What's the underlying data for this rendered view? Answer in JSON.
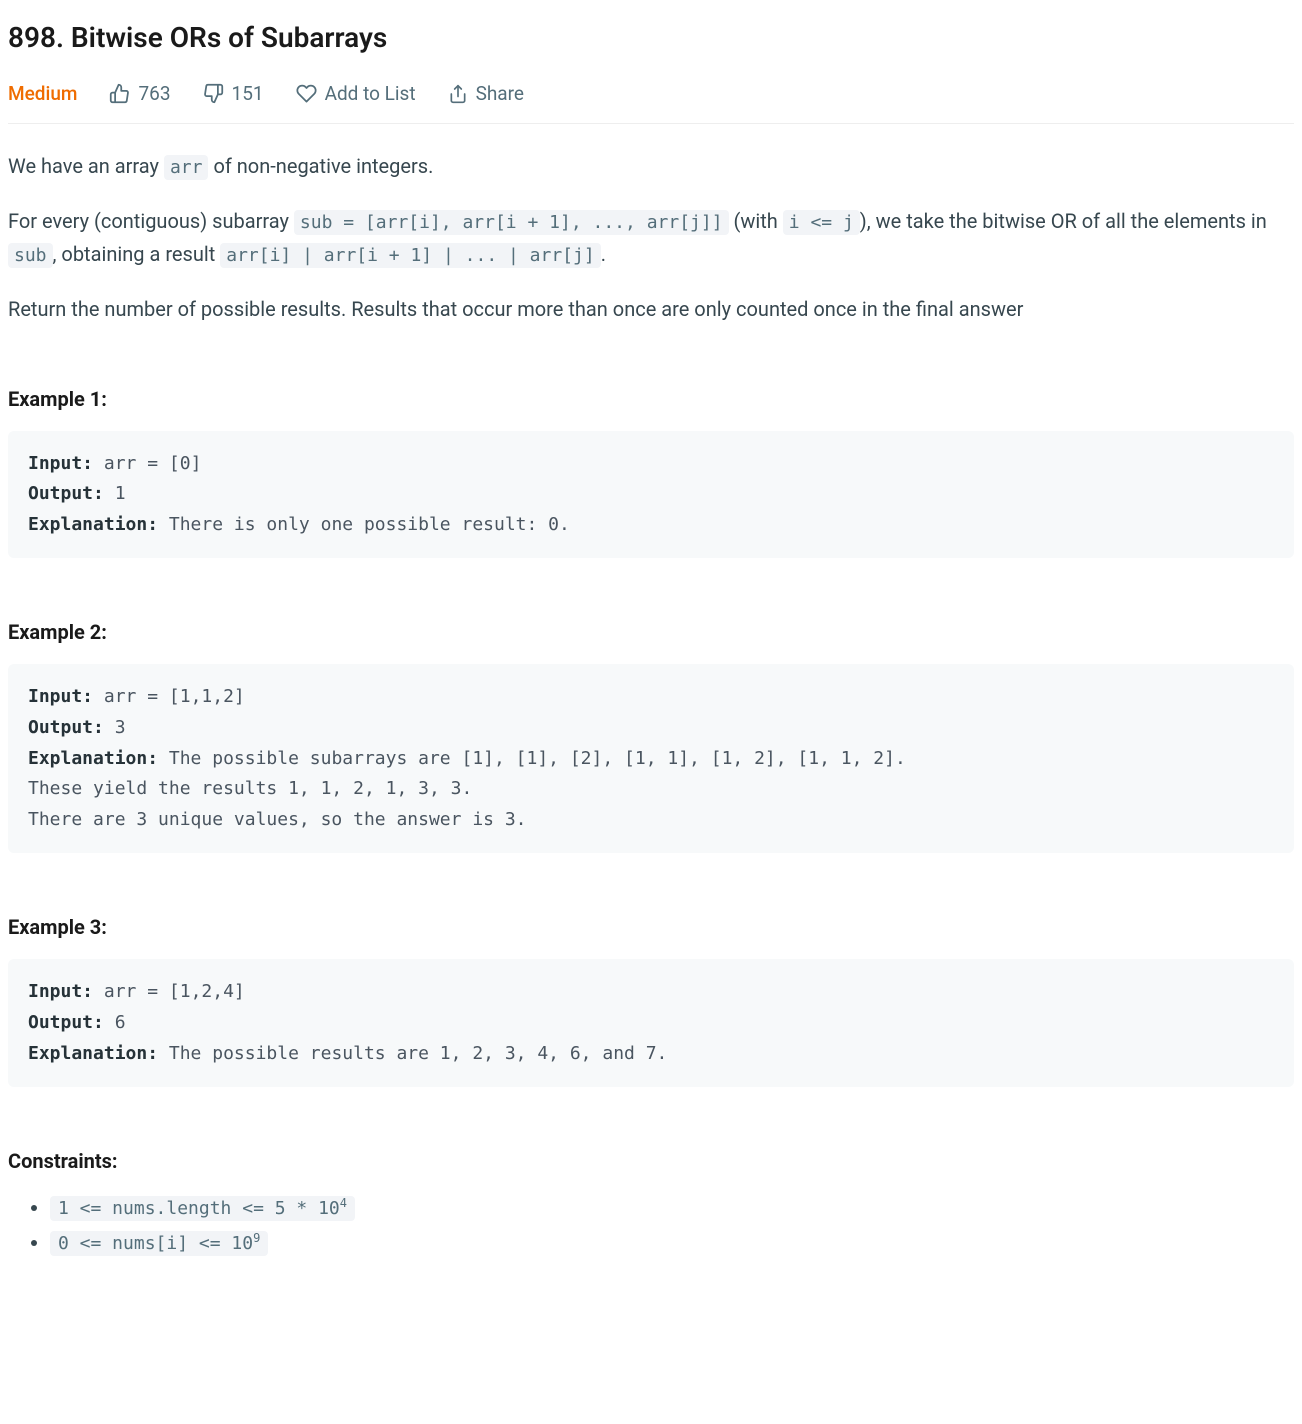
{
  "problem": {
    "id": "898",
    "title": "898. Bitwise ORs of Subarrays",
    "difficulty": "Medium"
  },
  "meta": {
    "likes": "763",
    "dislikes": "151",
    "add_to_list": "Add to List",
    "share": "Share"
  },
  "desc": {
    "p1_a": "We have an array ",
    "p1_code1": "arr",
    "p1_b": " of non-negative integers.",
    "p2_a": "For every (contiguous) subarray ",
    "p2_code1": "sub = [arr[i], arr[i + 1], ..., arr[j]]",
    "p2_b": " (with ",
    "p2_code2": "i <= j",
    "p2_c": "), we take the bitwise OR of all the elements in ",
    "p2_code3": "sub",
    "p2_d": ", obtaining a result ",
    "p2_code4": "arr[i] | arr[i + 1] | ... | arr[j]",
    "p2_e": ".",
    "p3": "Return the number of possible results. Results that occur more than once are only counted once in the final answer"
  },
  "examples": {
    "h1": "Example 1:",
    "e1": {
      "input_label": "Input:",
      "input": " arr = [0]",
      "output_label": "Output:",
      "output": " 1",
      "explanation_label": "Explanation:",
      "explanation": " There is only one possible result: 0."
    },
    "h2": "Example 2:",
    "e2": {
      "input_label": "Input:",
      "input": " arr = [1,1,2]",
      "output_label": "Output:",
      "output": " 3",
      "explanation_label": "Explanation:",
      "explanation": " The possible subarrays are [1], [1], [2], [1, 1], [1, 2], [1, 1, 2].\nThese yield the results 1, 1, 2, 1, 3, 3.\nThere are 3 unique values, so the answer is 3."
    },
    "h3": "Example 3:",
    "e3": {
      "input_label": "Input:",
      "input": " arr = [1,2,4]",
      "output_label": "Output:",
      "output": " 6",
      "explanation_label": "Explanation:",
      "explanation": " The possible results are 1, 2, 3, 4, 6, and 7."
    }
  },
  "constraints": {
    "heading": "Constraints:",
    "c1_a": "1 <= nums.length <= 5 * 10",
    "c1_sup": "4",
    "c2_a": "0 <= nums[i] <= 10",
    "c2_sup": "9"
  }
}
